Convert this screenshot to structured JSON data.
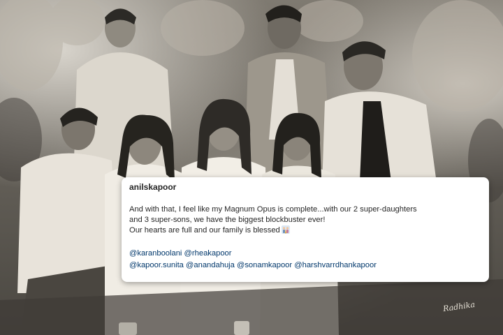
{
  "post": {
    "username": "anilskapoor",
    "caption_lines": [
      "And with that, I feel like my Magnum Opus is complete...with our 2 super-daughters",
      "and 3 super-sons, we have the biggest blockbuster ever!",
      "Our hearts are full and our family is blessed"
    ],
    "caption_emoji": "family-emoji-icon",
    "mentions_row1": [
      "@karanboolani",
      "@rheakapoor"
    ],
    "mentions_row2": [
      "@kapoor.sunita",
      "@anandahuja",
      "@sonamkapoor",
      "@harshvarrdhankapoor"
    ]
  },
  "photo": {
    "signature": "Radhika",
    "tone": "sepia-black-and-white"
  },
  "colors": {
    "card_bg": "#ffffff",
    "text": "#262626",
    "mention": "#00376b"
  }
}
